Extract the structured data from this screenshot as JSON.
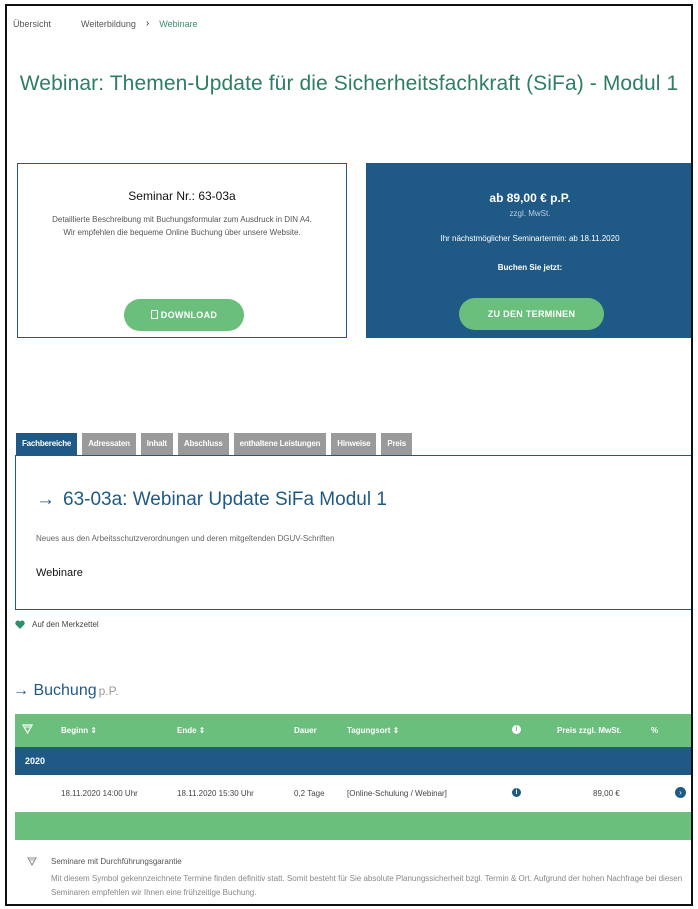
{
  "breadcrumb": {
    "items": [
      "Übersicht",
      "Weiterbildung"
    ],
    "separator": "›",
    "current": "Webinare"
  },
  "page_title": "Webinar: Themen-Update für die Sicherheitsfachkraft (SiFa) - Modul 1",
  "info_left": {
    "seminar_nr": "Seminar Nr.: 63-03a",
    "description": "Detaillierte Beschreibung mit Buchungsformular zum Ausdruck in DIN A4. Wir empfehlen die bequeme Online Buchung über unsere Website.",
    "download_label": "DOWNLOAD"
  },
  "info_right": {
    "price": "ab 89,00 € p.P.",
    "tax": "zzgl. MwSt.",
    "next_date": "Ihr nächstmöglicher Seminartermin: ab 18.11.2020",
    "book_now": "Buchen Sie jetzt:",
    "dates_label": "ZU DEN TERMINEN"
  },
  "tabs": [
    "Fachbereiche",
    "Adressaten",
    "Inhalt",
    "Abschluss",
    "enthaltene Leistungen",
    "Hinweise",
    "Preis"
  ],
  "panel": {
    "arrow": "→",
    "heading": "63-03a: Webinar Update SiFa Modul 1",
    "subtext": "Neues aus den Arbeitsschutzverordnungen und deren mitgeltenden DGUV-Schriften",
    "category": "Webinare"
  },
  "merkzettel": "Auf den Merkzettel",
  "booking": {
    "arrow": "→",
    "title": "Buchung",
    "pp": "p.P."
  },
  "table": {
    "headers": {
      "beginn": "Beginn ⇕",
      "ende": "Ende ⇕",
      "dauer": "Dauer",
      "ort": "Tagungsort ⇕",
      "info": "i",
      "preis": "Preis zzgl. MwSt.",
      "pct": "%"
    },
    "year": "2020",
    "row": {
      "beginn": "18.11.2020 14:00 Uhr",
      "ende": "18.11.2020 15:30 Uhr",
      "dauer": "0,2 Tage",
      "ort": "[Online-Schulung / Webinar]",
      "info": "i",
      "preis": "89,00 €",
      "go": "›"
    }
  },
  "guarantee": {
    "title": "Seminare mit Durchführungsgarantie",
    "text": "Mit diesem Symbol gekennzeichnete Termine finden definitiv statt. Somit besteht für Sie absolute Planungssicherheit bzgl. Termin & Ort. Aufgrund der hohen Nachfrage bei diesen Seminaren empfehlen wir Ihnen eine frühzeitige Buchung."
  },
  "colors": {
    "brand_green": "#6bbf7d",
    "brand_blue": "#1f5a86",
    "title_green": "#2f7d67"
  }
}
